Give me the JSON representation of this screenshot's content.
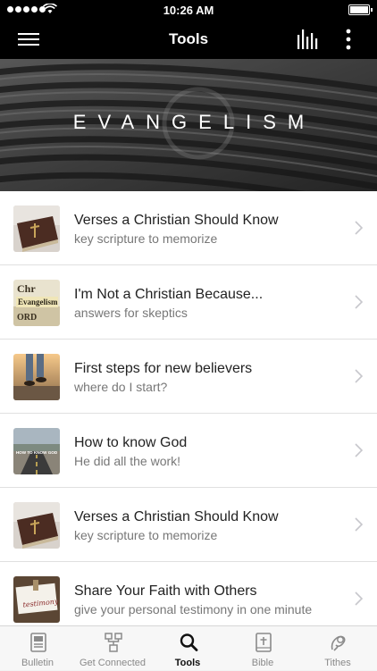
{
  "status_bar": {
    "time": "10:26 AM"
  },
  "nav": {
    "title": "Tools"
  },
  "hero": {
    "title": "EVANGELISM"
  },
  "list": [
    {
      "title": "Verses a Christian Should Know",
      "subtitle": "key scripture to memorize",
      "thumb": "bible-thumbnail"
    },
    {
      "title": "I'm Not a Christian Because...",
      "subtitle": "answers for skeptics",
      "thumb": "dictionary-evangelism-thumbnail",
      "thumb_text": [
        "Chr",
        "Evangelism",
        "ORD"
      ]
    },
    {
      "title": "First steps for new believers",
      "subtitle": "where do I start?",
      "thumb": "walking-feet-thumbnail"
    },
    {
      "title": "How to know God",
      "subtitle": "He did all the work!",
      "thumb": "road-thumbnail",
      "thumb_text": "HOW TO KNOW GOD"
    },
    {
      "title": "Verses a Christian Should Know",
      "subtitle": "key scripture to memorize",
      "thumb": "bible-thumbnail"
    },
    {
      "title": "Share Your Faith with Others",
      "subtitle": "give your personal testimony in one minute",
      "thumb": "testimony-note-thumbnail",
      "thumb_text": "testimony"
    }
  ],
  "tabs": [
    {
      "label": "Bulletin",
      "icon": "bulletin-icon",
      "active": false
    },
    {
      "label": "Get Connected",
      "icon": "connected-icon",
      "active": false
    },
    {
      "label": "Tools",
      "icon": "search-icon",
      "active": true
    },
    {
      "label": "Bible",
      "icon": "bible-icon",
      "active": false
    },
    {
      "label": "Tithes",
      "icon": "tithes-icon",
      "active": false
    }
  ],
  "colors": {
    "bar_bg": "#000000",
    "tab_active": "#111111",
    "tab_inactive": "#8a8a8a",
    "subtitle": "#777777"
  }
}
